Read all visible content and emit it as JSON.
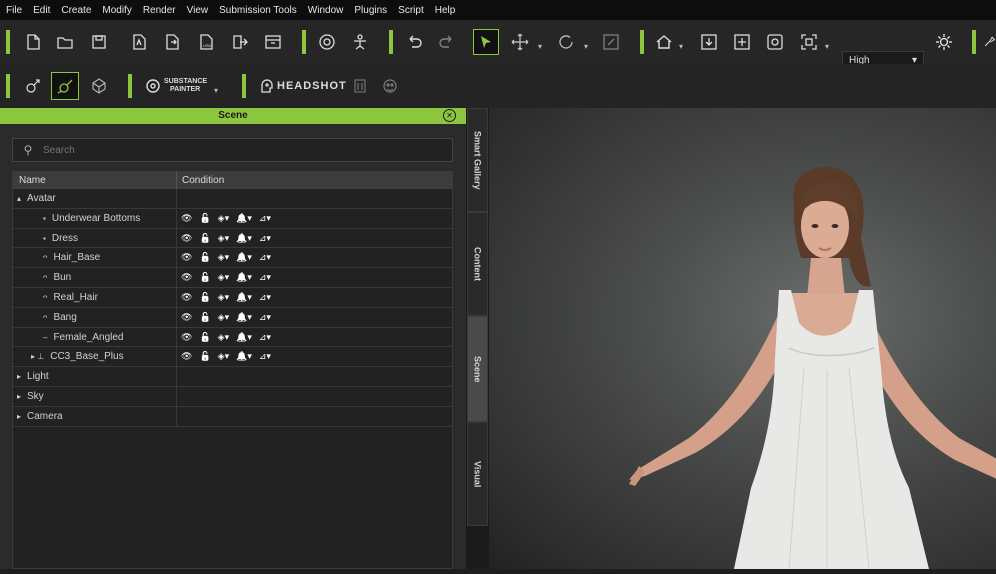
{
  "menu": [
    "File",
    "Edit",
    "Create",
    "Modify",
    "Render",
    "View",
    "Submission Tools",
    "Window",
    "Plugins",
    "Script",
    "Help"
  ],
  "toolbar": {
    "quality_value": "High",
    "substance_label_top": "SUBSTANCE",
    "substance_label_bottom": "PAINTER",
    "headshot_label": "HEADSHOT"
  },
  "panel": {
    "title": "Scene",
    "search_placeholder": "Search",
    "col_name": "Name",
    "col_condition": "Condition",
    "rows": [
      {
        "label": "Avatar",
        "prefix": "▴"
      },
      {
        "label": "Underwear Bottoms",
        "prefix": "▪"
      },
      {
        "label": "Dress",
        "prefix": "▪"
      },
      {
        "label": "Hair_Base",
        "prefix": "ᴖ"
      },
      {
        "label": "Bun",
        "prefix": "ᴖ"
      },
      {
        "label": "Real_Hair",
        "prefix": "ᴖ"
      },
      {
        "label": "Bang",
        "prefix": "ᴖ"
      },
      {
        "label": "Female_Angled",
        "prefix": "–"
      },
      {
        "label": "CC3_Base_Plus",
        "prefix": "⊥"
      },
      {
        "label": "Light",
        "prefix": "▸"
      },
      {
        "label": "Sky",
        "prefix": "▸"
      },
      {
        "label": "Camera",
        "prefix": "▸"
      }
    ]
  },
  "side_tabs": [
    "Smart Gallery",
    "Content",
    "Scene",
    "Visual"
  ],
  "colors": {
    "accent": "#8cc63f",
    "dress": "#e8e8e6",
    "skin": "#d9a58d",
    "hair": "#5a3a28"
  }
}
